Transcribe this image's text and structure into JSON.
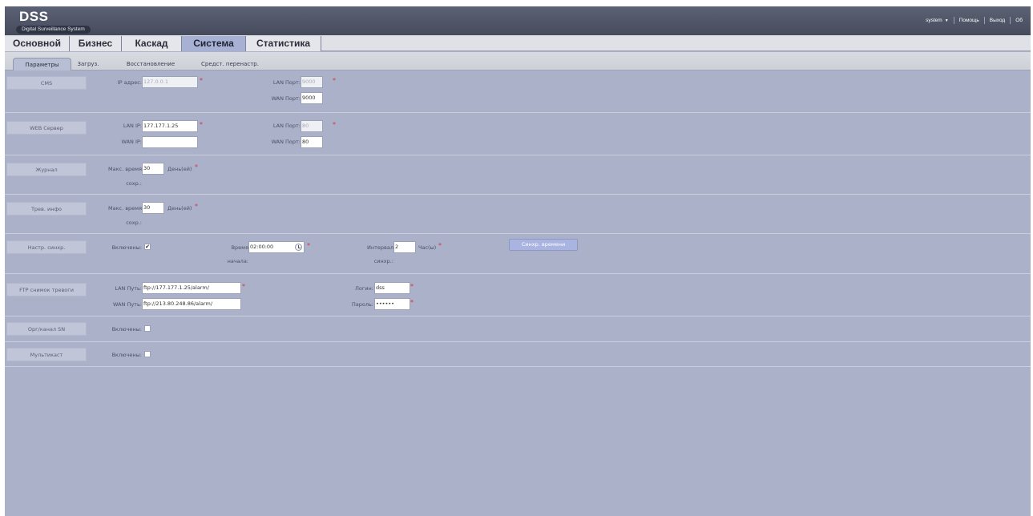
{
  "header": {
    "logo": "DSS",
    "subtitle": "Digital Surveillance System",
    "user": "system",
    "help": "Помощь",
    "logout": "Выход",
    "about": "Об"
  },
  "main_tabs": [
    "Основной",
    "Бизнес",
    "Каскад",
    "Система",
    "Статистика"
  ],
  "main_tab_active": "Система",
  "sub_tabs": [
    "Параметры",
    "Загруз.",
    "Восстановление",
    "Средст. перенастр."
  ],
  "sub_tab_active": "Параметры",
  "sections": {
    "cms": {
      "label": "CMS",
      "ip_label": "IP адрес:",
      "ip_value": "127.0.0.1",
      "lan_port_label": "LAN Порт:",
      "lan_port_value": "9000",
      "wan_port_label": "WAN Порт:",
      "wan_port_value": "9000"
    },
    "web": {
      "label": "WEB Сервер",
      "lan_ip_label": "LAN IP:",
      "lan_ip_value": "177.177.1.25",
      "wan_ip_label": "WAN IP:",
      "wan_ip_value": "",
      "lan_port_label": "LAN Порт:",
      "lan_port_value": "80",
      "wan_port_label": "WAN Порт:",
      "wan_port_value": "80"
    },
    "journal": {
      "label": "Журнал",
      "max_time_label_1": "Макс. время",
      "max_time_label_2": "сохр.:",
      "value": "30",
      "unit": "День(ей)"
    },
    "alarm_info": {
      "label": "Трев. инфо",
      "max_time_label_1": "Макс. время",
      "max_time_label_2": "сохр.:",
      "value": "30",
      "unit": "День(ей)"
    },
    "sync": {
      "label": "Настр. синхр.",
      "enabled_label": "Включены:",
      "enabled": true,
      "start_label_1": "Время",
      "start_label_2": "начала:",
      "start_value": "02:00:00",
      "interval_label_1": "Интервал",
      "interval_label_2": "синхр.:",
      "interval_value": "2",
      "interval_unit": "Час(ы)",
      "sync_button": "Синхр. времени"
    },
    "ftp": {
      "label": "FTP снимок тревоги",
      "lan_path_label": "LAN Путь:",
      "lan_path_value": "ftp://177.177.1.25/alarm/",
      "wan_path_label": "WAN Путь:",
      "wan_path_value": "ftp://213.80.248.86/alarm/",
      "login_label": "Логин:",
      "login_value": "dss",
      "password_label": "Пароль:",
      "password_value": "••••••"
    },
    "org_sn": {
      "label": "Орг/канал SN",
      "enabled_label": "Включены:",
      "enabled": false
    },
    "multicast": {
      "label": "Мультикаст",
      "enabled_label": "Включены:",
      "enabled": false
    }
  }
}
